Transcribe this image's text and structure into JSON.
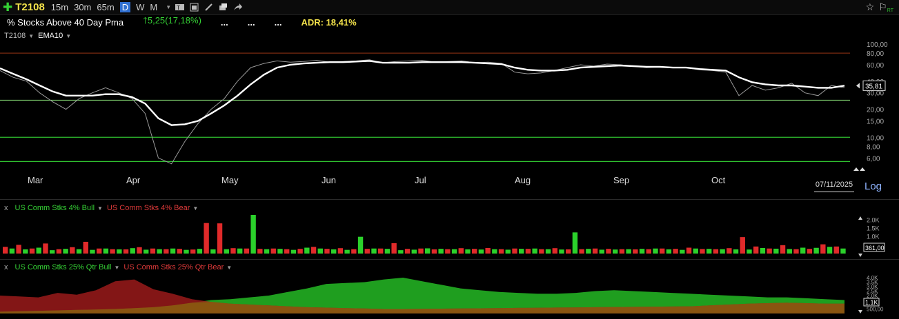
{
  "toolbar": {
    "symbol": "T2108",
    "timeframes": [
      "15m",
      "30m",
      "65m",
      "D",
      "W",
      "M"
    ],
    "active_timeframe": "D",
    "icons": [
      "add-icon",
      "compare-icon",
      "calendar-icon",
      "pencil-icon",
      "tools-icon",
      "share-icon"
    ]
  },
  "header": {
    "title": "% Stocks Above 40 Day Pma",
    "change": "5,25(17,18%)",
    "dots": [
      "...",
      "...",
      "..."
    ],
    "adr": "ADR: 18,41%"
  },
  "chart_data": [
    {
      "type": "line",
      "legend": [
        "T2108",
        "EMA10"
      ],
      "x": [
        "Mar",
        "Apr",
        "May",
        "Jun",
        "Jul",
        "Aug",
        "Sep",
        "Oct"
      ],
      "yscale": "log",
      "ylim": [
        5,
        100
      ],
      "y_ticks": [
        "100,00",
        "80,00",
        "60,00",
        "40,00",
        "30,00",
        "20,00",
        "15,00",
        "10,00",
        "8,00",
        "6,00"
      ],
      "last_value": "35,81",
      "last_date": "07/11/2025",
      "scale_label": "Log",
      "reference_lines": [
        {
          "value": 80,
          "color": "#7a2a10"
        },
        {
          "value": 25,
          "color": "#7ecf6e"
        },
        {
          "value": 10,
          "color": "#2fbf2f"
        },
        {
          "value": 5.5,
          "color": "#2fbf2f"
        }
      ],
      "series": [
        {
          "name": "T2108",
          "color": "#9a9a9a",
          "values": [
            52,
            44,
            40,
            30,
            24,
            20,
            26,
            30,
            34,
            30,
            26,
            18,
            6,
            5.2,
            9,
            14,
            20,
            26,
            40,
            56,
            62,
            66,
            64,
            65,
            67,
            64,
            65,
            66,
            68,
            63,
            65,
            66,
            67,
            64,
            65,
            66,
            63,
            64,
            62,
            50,
            48,
            49,
            52,
            56,
            60,
            58,
            61,
            60,
            58,
            56,
            57,
            56,
            56,
            53,
            52,
            50,
            28,
            36,
            32,
            34,
            38,
            30,
            28,
            36,
            34
          ]
        },
        {
          "name": "EMA10",
          "color": "#ffffff",
          "values": [
            55,
            48,
            42,
            36,
            31,
            28,
            28,
            28,
            29,
            29,
            27,
            23,
            16,
            13.5,
            13.8,
            15,
            18,
            22,
            28,
            37,
            47,
            56,
            60,
            62,
            63,
            64,
            64,
            65,
            66,
            63,
            63,
            63,
            64,
            64,
            64,
            64,
            63,
            62,
            61,
            56,
            53,
            52,
            52,
            53,
            56,
            57,
            58,
            59,
            58,
            57,
            57,
            56,
            56,
            54,
            53,
            52,
            44,
            39,
            37,
            36,
            36,
            35,
            34,
            34,
            35.8
          ]
        }
      ]
    },
    {
      "type": "bar",
      "ylim": [
        0,
        2300
      ],
      "y_ticks": [
        "2.0K",
        "1.5K",
        "1.0K",
        "500"
      ],
      "last_value": "361,00",
      "series": [
        {
          "name": "US Comm Stks 4% Bull",
          "color": "#2bd12b",
          "values": [
            300,
            250,
            350,
            200,
            280,
            260,
            220,
            300,
            250,
            320,
            230,
            260,
            300,
            220,
            280,
            250,
            260,
            300,
            2300,
            260,
            280,
            220,
            350,
            300,
            250,
            220,
            1000,
            300,
            280,
            200,
            230,
            310,
            280,
            260,
            250,
            240,
            260,
            230,
            280,
            300,
            260,
            240,
            1260,
            280,
            230,
            240,
            260,
            280,
            300,
            250,
            220,
            300,
            280,
            260,
            250,
            240,
            330,
            290,
            270,
            350,
            340,
            400,
            300
          ]
        },
        {
          "name": "US Comm Stks 4% Bear",
          "color": "#e02a2a",
          "values": [
            400,
            520,
            300,
            600,
            260,
            380,
            700,
            300,
            260,
            250,
            380,
            300,
            260,
            280,
            240,
            1820,
            1800,
            320,
            300,
            280,
            300,
            260,
            280,
            400,
            280,
            320,
            260,
            280,
            300,
            620,
            280,
            300,
            250,
            260,
            320,
            280,
            330,
            260,
            300,
            280,
            260,
            320,
            250,
            260,
            300,
            280,
            260,
            250,
            260,
            300,
            280,
            350,
            270,
            260,
            320,
            980,
            420,
            300,
            500,
            260,
            280,
            550,
            420
          ]
        }
      ]
    },
    {
      "type": "area",
      "ylim": [
        0,
        4000
      ],
      "y_ticks": [
        "4.0K",
        "3.5K",
        "3.0K",
        "2.5K",
        "2.0K",
        "1.5K",
        "500,00"
      ],
      "last_value": "1.1K",
      "series": [
        {
          "name": "US Comm Stks 25% Qtr Bull",
          "color": "#1f9e1f",
          "values": [
            200,
            250,
            300,
            350,
            400,
            450,
            500,
            600,
            700,
            900,
            1200,
            1500,
            1600,
            1800,
            2000,
            2400,
            2800,
            3300,
            3400,
            3500,
            3800,
            4000,
            3600,
            3200,
            2800,
            2600,
            2400,
            2300,
            2200,
            2200,
            2300,
            2500,
            2600,
            2500,
            2400,
            2300,
            2200,
            2100,
            2000,
            1900,
            1800,
            1800,
            1700,
            1600,
            1500
          ]
        },
        {
          "name": "US Comm Stks 25% Qtr Bear",
          "color": "#9a1a1a",
          "values": [
            2000,
            1900,
            1800,
            2300,
            2100,
            2600,
            3600,
            3800,
            2700,
            2200,
            1600,
            1300,
            1100,
            1000,
            900,
            800,
            700,
            650,
            600,
            550,
            500,
            500,
            520,
            540,
            560,
            580,
            600,
            620,
            640,
            660,
            680,
            700,
            720,
            740,
            760,
            780,
            800,
            900,
            1000,
            1100,
            1150,
            1200,
            1150,
            1100,
            1100
          ]
        }
      ]
    }
  ]
}
